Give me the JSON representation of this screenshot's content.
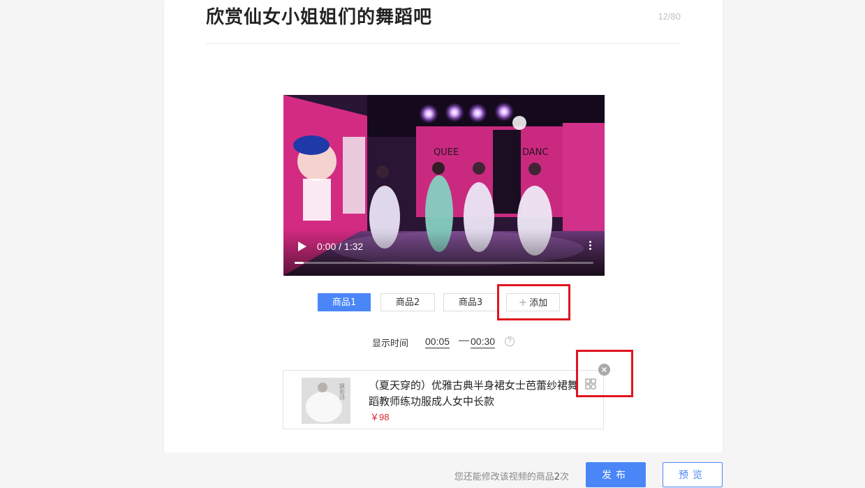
{
  "header": {
    "title": "欣赏仙女小姐姐们的舞蹈吧",
    "char_counter": "12/80"
  },
  "video": {
    "time_display": "0:00 / 1:32",
    "progress_fraction": 0.03,
    "wall_text_left": "QUEE",
    "wall_text_right": "DANC"
  },
  "product_tabs": [
    {
      "label": "商品1",
      "active": true
    },
    {
      "label": "商品2",
      "active": false
    },
    {
      "label": "商品3",
      "active": false
    }
  ],
  "add_button": {
    "icon": "plus-icon",
    "label": "添加"
  },
  "display_time": {
    "label": "显示时间",
    "start": "00:05",
    "separator": "—",
    "end": "00:30",
    "help_icon": "question-icon",
    "help_glyph": "?"
  },
  "product": {
    "title": "（夏天穿的）优雅古典半身裙女士芭蕾纱裙舞蹈教师练功服成人女中长款",
    "price": "￥98",
    "qr_icon": "qr-code-icon",
    "remove_icon": "close-icon",
    "thumbnail_text": "飘若诗"
  },
  "footer": {
    "hint_prefix": "您还能修改该视频的商品",
    "hint_count": "2",
    "hint_suffix": "次",
    "publish_label": "发布",
    "preview_label": "预览"
  },
  "colors": {
    "accent": "#4a86f7",
    "highlight_box": "#e0141e",
    "price": "#d9242b"
  }
}
